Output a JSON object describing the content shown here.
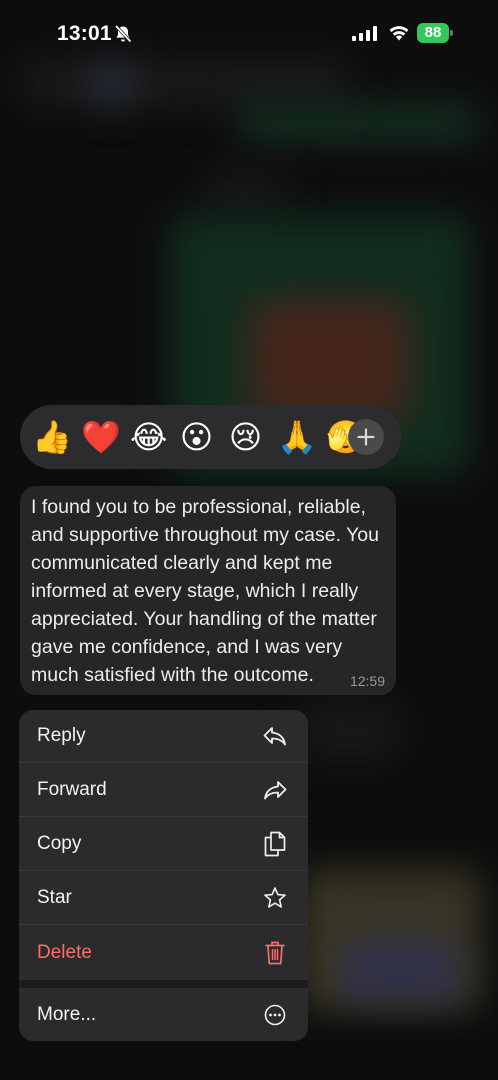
{
  "status_bar": {
    "time": "13:01",
    "battery": "88"
  },
  "reactions": {
    "emojis": [
      {
        "glyph": "👍",
        "name": "thumbs-up"
      },
      {
        "glyph": "❤️",
        "name": "red-heart"
      },
      {
        "glyph": "😂",
        "name": "tears-of-joy"
      },
      {
        "glyph": "😮",
        "name": "surprised"
      },
      {
        "glyph": "😢",
        "name": "crying"
      },
      {
        "glyph": "🙏",
        "name": "folded-hands"
      },
      {
        "glyph": "🫣",
        "name": "peeking"
      }
    ],
    "more_icon": "plus-icon"
  },
  "message": {
    "text": "I found you to be professional, reliable, and supportive throughout my case. You communicated clearly and kept me informed at every stage, which I really appreciated. Your handling of the matter gave me confidence, and I was very much satisfied with the outcome.",
    "time": "12:59"
  },
  "menu": {
    "reply": "Reply",
    "forward": "Forward",
    "copy": "Copy",
    "star": "Star",
    "delete": "Delete",
    "more": "More...",
    "delete_color": "#ff6b6b"
  }
}
